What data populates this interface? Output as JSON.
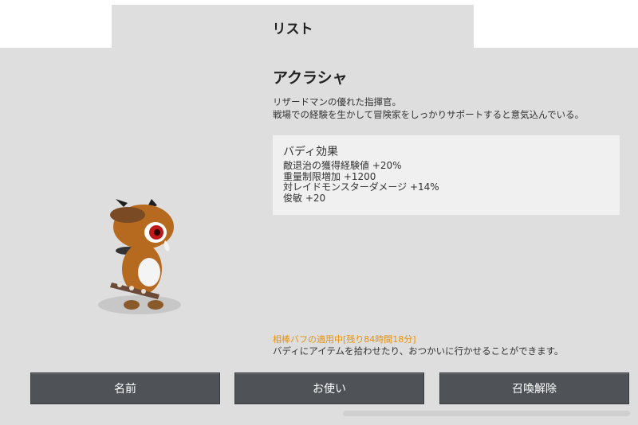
{
  "tab": {
    "label": "リスト"
  },
  "character": {
    "name": "アクラシャ",
    "description_lines": [
      "リザードマンの優れた指揮官。",
      "戦場での経験を生かして冒険家をしっかりサポートすると意気込んでいる。"
    ]
  },
  "buddy_effect": {
    "title": "バディ効果",
    "effects": [
      "敵退治の獲得経験値 +20%",
      "重量制限増加 +1200",
      "対レイドモンスターダメージ +14%",
      "俊敏 +20"
    ]
  },
  "buff_status": "相棒バフの適用中[残り84時間18分]",
  "hint": "バディにアイテムを拾わせたり、おつかいに行かせることができます。",
  "buttons": {
    "name": "名前",
    "use": "お使い",
    "release": "召喚解除"
  },
  "colors": {
    "buff_text": "#e8900c",
    "button_bg": "#4f5357",
    "panel_bg": "#dedede"
  }
}
